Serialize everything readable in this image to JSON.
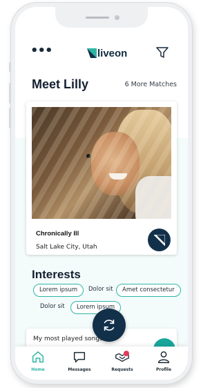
{
  "colors": {
    "accent": "#2cb6a4",
    "dark": "#12304a",
    "badge": "#e23b5a"
  },
  "header": {
    "menu_icon": "more-dots-icon",
    "logo_text": "liveon",
    "filter_icon": "filter-icon"
  },
  "profile": {
    "title": "Meet Lilly",
    "more_matches": "6 More Matches",
    "condition": "Chronically Ill",
    "location": "Salt Lake City, Utah",
    "action_icon": "triangle-corner-icon"
  },
  "interests": {
    "title": "Interests",
    "tags": [
      {
        "label": "Lorem ipsum",
        "outlined": true
      },
      {
        "label": "Dolor sit",
        "outlined": false
      },
      {
        "label": "Amet consectetur",
        "outlined": true
      },
      {
        "label": "Dolor sit",
        "outlined": false
      },
      {
        "label": "Lorem ipsum",
        "outlined": true
      }
    ]
  },
  "bottom_card": {
    "text": "My most played songs..."
  },
  "fab_icon": "refresh-icon",
  "scroll_icon": "chevron-up-icon",
  "nav": {
    "items": [
      {
        "label": "Home",
        "icon": "home-icon",
        "active": true
      },
      {
        "label": "Messages",
        "icon": "chat-icon",
        "active": false
      },
      {
        "label": "Requests",
        "icon": "handshake-icon",
        "active": false,
        "badge": true
      },
      {
        "label": "Profile",
        "icon": "person-icon",
        "active": false
      }
    ]
  }
}
